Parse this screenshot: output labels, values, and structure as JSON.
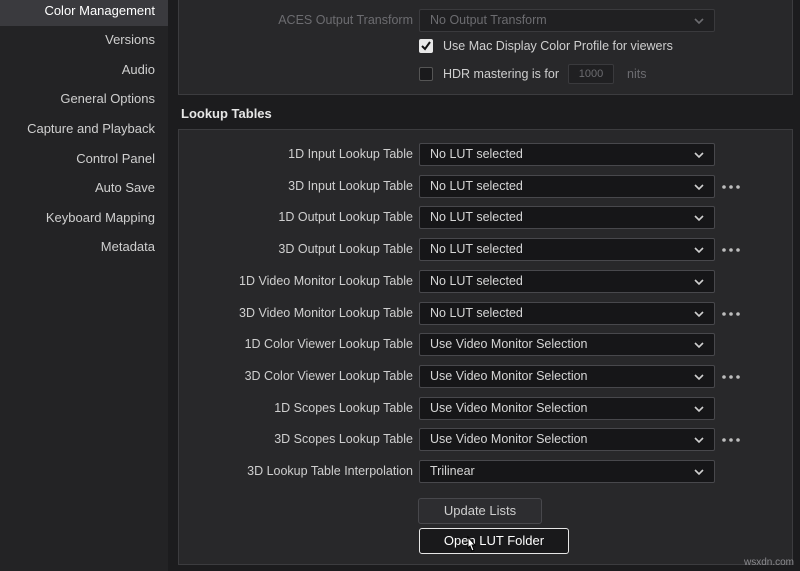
{
  "sidebar": {
    "items": [
      {
        "label": "Color Management",
        "active": true
      },
      {
        "label": "Versions"
      },
      {
        "label": "Audio"
      },
      {
        "label": "General Options"
      },
      {
        "label": "Capture and Playback"
      },
      {
        "label": "Control Panel"
      },
      {
        "label": "Auto Save"
      },
      {
        "label": "Keyboard Mapping"
      },
      {
        "label": "Metadata"
      }
    ]
  },
  "top_panel": {
    "aces_label": "ACES Output Transform",
    "aces_value": "No Output Transform",
    "mac_profile_label": "Use Mac Display Color Profile for viewers",
    "mac_profile_checked": true,
    "hdr_label": "HDR mastering is for",
    "hdr_checked": false,
    "hdr_value": "1000",
    "hdr_unit": "nits"
  },
  "lookup_tables": {
    "title": "Lookup Tables",
    "rows": [
      {
        "label": "1D Input Lookup Table",
        "value": "No LUT selected",
        "more": false
      },
      {
        "label": "3D Input Lookup Table",
        "value": "No LUT selected",
        "more": true
      },
      {
        "label": "1D Output Lookup Table",
        "value": "No LUT selected",
        "more": false
      },
      {
        "label": "3D Output Lookup Table",
        "value": "No LUT selected",
        "more": true
      },
      {
        "label": "1D Video Monitor Lookup Table",
        "value": "No LUT selected",
        "more": false
      },
      {
        "label": "3D Video Monitor Lookup Table",
        "value": "No LUT selected",
        "more": true
      },
      {
        "label": "1D Color Viewer Lookup Table",
        "value": "Use Video Monitor Selection",
        "more": false
      },
      {
        "label": "3D Color Viewer Lookup Table",
        "value": "Use Video Monitor Selection",
        "more": true
      },
      {
        "label": "1D Scopes Lookup Table",
        "value": "Use Video Monitor Selection",
        "more": false
      },
      {
        "label": "3D Scopes Lookup Table",
        "value": "Use Video Monitor Selection",
        "more": true
      },
      {
        "label": "3D Lookup Table Interpolation",
        "value": "Trilinear",
        "more": false
      }
    ],
    "update_button": "Update Lists",
    "open_button": "Open LUT Folder"
  },
  "watermark": "wsxdn.com"
}
